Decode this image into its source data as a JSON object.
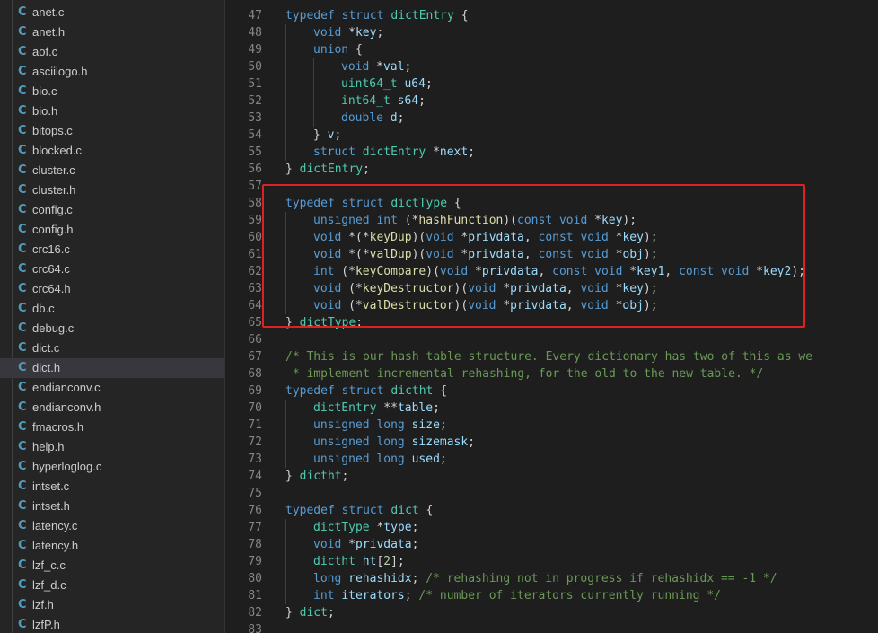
{
  "sidebar": {
    "files": [
      {
        "name": "anet.c",
        "icon": "C"
      },
      {
        "name": "anet.h",
        "icon": "C"
      },
      {
        "name": "aof.c",
        "icon": "C"
      },
      {
        "name": "asciilogo.h",
        "icon": "C"
      },
      {
        "name": "bio.c",
        "icon": "C"
      },
      {
        "name": "bio.h",
        "icon": "C"
      },
      {
        "name": "bitops.c",
        "icon": "C"
      },
      {
        "name": "blocked.c",
        "icon": "C"
      },
      {
        "name": "cluster.c",
        "icon": "C"
      },
      {
        "name": "cluster.h",
        "icon": "C"
      },
      {
        "name": "config.c",
        "icon": "C"
      },
      {
        "name": "config.h",
        "icon": "C"
      },
      {
        "name": "crc16.c",
        "icon": "C"
      },
      {
        "name": "crc64.c",
        "icon": "C"
      },
      {
        "name": "crc64.h",
        "icon": "C"
      },
      {
        "name": "db.c",
        "icon": "C"
      },
      {
        "name": "debug.c",
        "icon": "C"
      },
      {
        "name": "dict.c",
        "icon": "C"
      },
      {
        "name": "dict.h",
        "icon": "C",
        "active": true
      },
      {
        "name": "endianconv.c",
        "icon": "C"
      },
      {
        "name": "endianconv.h",
        "icon": "C"
      },
      {
        "name": "fmacros.h",
        "icon": "C"
      },
      {
        "name": "help.h",
        "icon": "C"
      },
      {
        "name": "hyperloglog.c",
        "icon": "C"
      },
      {
        "name": "intset.c",
        "icon": "C"
      },
      {
        "name": "intset.h",
        "icon": "C"
      },
      {
        "name": "latency.c",
        "icon": "C"
      },
      {
        "name": "latency.h",
        "icon": "C"
      },
      {
        "name": "lzf_c.c",
        "icon": "C"
      },
      {
        "name": "lzf_d.c",
        "icon": "C"
      },
      {
        "name": "lzf.h",
        "icon": "C"
      },
      {
        "name": "lzfP.h",
        "icon": "C"
      }
    ]
  },
  "editor": {
    "highlight_color": "#e02020",
    "lines": [
      {
        "n": "47",
        "i": 0,
        "t": [
          [
            "kw",
            "typedef"
          ],
          [
            "tx",
            " "
          ],
          [
            "kw",
            "struct"
          ],
          [
            "tx",
            " "
          ],
          [
            "ty",
            "dictEntry"
          ],
          [
            "tx",
            " {"
          ]
        ]
      },
      {
        "n": "48",
        "i": 1,
        "t": [
          [
            "kw",
            "void"
          ],
          [
            "tx",
            " *"
          ],
          [
            "vr",
            "key"
          ],
          [
            "tx",
            ";"
          ]
        ]
      },
      {
        "n": "49",
        "i": 1,
        "t": [
          [
            "kw",
            "union"
          ],
          [
            "tx",
            " {"
          ]
        ]
      },
      {
        "n": "50",
        "i": 2,
        "t": [
          [
            "kw",
            "void"
          ],
          [
            "tx",
            " *"
          ],
          [
            "vr",
            "val"
          ],
          [
            "tx",
            ";"
          ]
        ]
      },
      {
        "n": "51",
        "i": 2,
        "t": [
          [
            "ty",
            "uint64_t"
          ],
          [
            "tx",
            " "
          ],
          [
            "vr",
            "u64"
          ],
          [
            "tx",
            ";"
          ]
        ]
      },
      {
        "n": "52",
        "i": 2,
        "t": [
          [
            "ty",
            "int64_t"
          ],
          [
            "tx",
            " "
          ],
          [
            "vr",
            "s64"
          ],
          [
            "tx",
            ";"
          ]
        ]
      },
      {
        "n": "53",
        "i": 2,
        "t": [
          [
            "kw",
            "double"
          ],
          [
            "tx",
            " "
          ],
          [
            "vr",
            "d"
          ],
          [
            "tx",
            ";"
          ]
        ]
      },
      {
        "n": "54",
        "i": 1,
        "t": [
          [
            "tx",
            "} "
          ],
          [
            "vr",
            "v"
          ],
          [
            "tx",
            ";"
          ]
        ]
      },
      {
        "n": "55",
        "i": 1,
        "t": [
          [
            "kw",
            "struct"
          ],
          [
            "tx",
            " "
          ],
          [
            "ty",
            "dictEntry"
          ],
          [
            "tx",
            " *"
          ],
          [
            "vr",
            "next"
          ],
          [
            "tx",
            ";"
          ]
        ]
      },
      {
        "n": "56",
        "i": 0,
        "t": [
          [
            "tx",
            "} "
          ],
          [
            "ty",
            "dictEntry"
          ],
          [
            "tx",
            ";"
          ]
        ]
      },
      {
        "n": "57",
        "i": 0,
        "t": []
      },
      {
        "n": "58",
        "i": 0,
        "t": [
          [
            "kw",
            "typedef"
          ],
          [
            "tx",
            " "
          ],
          [
            "kw",
            "struct"
          ],
          [
            "tx",
            " "
          ],
          [
            "ty",
            "dictType"
          ],
          [
            "tx",
            " {"
          ]
        ]
      },
      {
        "n": "59",
        "i": 1,
        "t": [
          [
            "kw",
            "unsigned"
          ],
          [
            "tx",
            " "
          ],
          [
            "kw",
            "int"
          ],
          [
            "tx",
            " (*"
          ],
          [
            "fn",
            "hashFunction"
          ],
          [
            "tx",
            ")("
          ],
          [
            "kw",
            "const"
          ],
          [
            "tx",
            " "
          ],
          [
            "kw",
            "void"
          ],
          [
            "tx",
            " *"
          ],
          [
            "vr",
            "key"
          ],
          [
            "tx",
            ");"
          ]
        ]
      },
      {
        "n": "60",
        "i": 1,
        "t": [
          [
            "kw",
            "void"
          ],
          [
            "tx",
            " *(*"
          ],
          [
            "fn",
            "keyDup"
          ],
          [
            "tx",
            ")("
          ],
          [
            "kw",
            "void"
          ],
          [
            "tx",
            " *"
          ],
          [
            "vr",
            "privdata"
          ],
          [
            "tx",
            ", "
          ],
          [
            "kw",
            "const"
          ],
          [
            "tx",
            " "
          ],
          [
            "kw",
            "void"
          ],
          [
            "tx",
            " *"
          ],
          [
            "vr",
            "key"
          ],
          [
            "tx",
            ");"
          ]
        ]
      },
      {
        "n": "61",
        "i": 1,
        "t": [
          [
            "kw",
            "void"
          ],
          [
            "tx",
            " *(*"
          ],
          [
            "fn",
            "valDup"
          ],
          [
            "tx",
            ")("
          ],
          [
            "kw",
            "void"
          ],
          [
            "tx",
            " *"
          ],
          [
            "vr",
            "privdata"
          ],
          [
            "tx",
            ", "
          ],
          [
            "kw",
            "const"
          ],
          [
            "tx",
            " "
          ],
          [
            "kw",
            "void"
          ],
          [
            "tx",
            " *"
          ],
          [
            "vr",
            "obj"
          ],
          [
            "tx",
            ");"
          ]
        ]
      },
      {
        "n": "62",
        "i": 1,
        "t": [
          [
            "kw",
            "int"
          ],
          [
            "tx",
            " (*"
          ],
          [
            "fn",
            "keyCompare"
          ],
          [
            "tx",
            ")("
          ],
          [
            "kw",
            "void"
          ],
          [
            "tx",
            " *"
          ],
          [
            "vr",
            "privdata"
          ],
          [
            "tx",
            ", "
          ],
          [
            "kw",
            "const"
          ],
          [
            "tx",
            " "
          ],
          [
            "kw",
            "void"
          ],
          [
            "tx",
            " *"
          ],
          [
            "vr",
            "key1"
          ],
          [
            "tx",
            ", "
          ],
          [
            "kw",
            "const"
          ],
          [
            "tx",
            " "
          ],
          [
            "kw",
            "void"
          ],
          [
            "tx",
            " *"
          ],
          [
            "vr",
            "key2"
          ],
          [
            "tx",
            ");"
          ]
        ]
      },
      {
        "n": "63",
        "i": 1,
        "t": [
          [
            "kw",
            "void"
          ],
          [
            "tx",
            " (*"
          ],
          [
            "fn",
            "keyDestructor"
          ],
          [
            "tx",
            ")("
          ],
          [
            "kw",
            "void"
          ],
          [
            "tx",
            " *"
          ],
          [
            "vr",
            "privdata"
          ],
          [
            "tx",
            ", "
          ],
          [
            "kw",
            "void"
          ],
          [
            "tx",
            " *"
          ],
          [
            "vr",
            "key"
          ],
          [
            "tx",
            ");"
          ]
        ]
      },
      {
        "n": "64",
        "i": 1,
        "t": [
          [
            "kw",
            "void"
          ],
          [
            "tx",
            " (*"
          ],
          [
            "fn",
            "valDestructor"
          ],
          [
            "tx",
            ")("
          ],
          [
            "kw",
            "void"
          ],
          [
            "tx",
            " *"
          ],
          [
            "vr",
            "privdata"
          ],
          [
            "tx",
            ", "
          ],
          [
            "kw",
            "void"
          ],
          [
            "tx",
            " *"
          ],
          [
            "vr",
            "obj"
          ],
          [
            "tx",
            ");"
          ]
        ]
      },
      {
        "n": "65",
        "i": 0,
        "t": [
          [
            "tx",
            "} "
          ],
          [
            "ty",
            "dictType"
          ],
          [
            "tx",
            ";"
          ]
        ]
      },
      {
        "n": "66",
        "i": 0,
        "t": []
      },
      {
        "n": "67",
        "i": 0,
        "t": [
          [
            "cm",
            "/* This is our hash table structure. Every dictionary has two of this as we"
          ]
        ]
      },
      {
        "n": "68",
        "i": 0,
        "t": [
          [
            "cm",
            " * implement incremental rehashing, for the old to the new table. */"
          ]
        ]
      },
      {
        "n": "69",
        "i": 0,
        "t": [
          [
            "kw",
            "typedef"
          ],
          [
            "tx",
            " "
          ],
          [
            "kw",
            "struct"
          ],
          [
            "tx",
            " "
          ],
          [
            "ty",
            "dictht"
          ],
          [
            "tx",
            " {"
          ]
        ]
      },
      {
        "n": "70",
        "i": 1,
        "t": [
          [
            "ty",
            "dictEntry"
          ],
          [
            "tx",
            " **"
          ],
          [
            "vr",
            "table"
          ],
          [
            "tx",
            ";"
          ]
        ]
      },
      {
        "n": "71",
        "i": 1,
        "t": [
          [
            "kw",
            "unsigned"
          ],
          [
            "tx",
            " "
          ],
          [
            "kw",
            "long"
          ],
          [
            "tx",
            " "
          ],
          [
            "vr",
            "size"
          ],
          [
            "tx",
            ";"
          ]
        ]
      },
      {
        "n": "72",
        "i": 1,
        "t": [
          [
            "kw",
            "unsigned"
          ],
          [
            "tx",
            " "
          ],
          [
            "kw",
            "long"
          ],
          [
            "tx",
            " "
          ],
          [
            "vr",
            "sizemask"
          ],
          [
            "tx",
            ";"
          ]
        ]
      },
      {
        "n": "73",
        "i": 1,
        "t": [
          [
            "kw",
            "unsigned"
          ],
          [
            "tx",
            " "
          ],
          [
            "kw",
            "long"
          ],
          [
            "tx",
            " "
          ],
          [
            "vr",
            "used"
          ],
          [
            "tx",
            ";"
          ]
        ]
      },
      {
        "n": "74",
        "i": 0,
        "t": [
          [
            "tx",
            "} "
          ],
          [
            "ty",
            "dictht"
          ],
          [
            "tx",
            ";"
          ]
        ]
      },
      {
        "n": "75",
        "i": 0,
        "t": []
      },
      {
        "n": "76",
        "i": 0,
        "t": [
          [
            "kw",
            "typedef"
          ],
          [
            "tx",
            " "
          ],
          [
            "kw",
            "struct"
          ],
          [
            "tx",
            " "
          ],
          [
            "ty",
            "dict"
          ],
          [
            "tx",
            " {"
          ]
        ]
      },
      {
        "n": "77",
        "i": 1,
        "t": [
          [
            "ty",
            "dictType"
          ],
          [
            "tx",
            " *"
          ],
          [
            "vr",
            "type"
          ],
          [
            "tx",
            ";"
          ]
        ]
      },
      {
        "n": "78",
        "i": 1,
        "t": [
          [
            "kw",
            "void"
          ],
          [
            "tx",
            " *"
          ],
          [
            "vr",
            "privdata"
          ],
          [
            "tx",
            ";"
          ]
        ]
      },
      {
        "n": "79",
        "i": 1,
        "t": [
          [
            "ty",
            "dictht"
          ],
          [
            "tx",
            " "
          ],
          [
            "vr",
            "ht"
          ],
          [
            "tx",
            "["
          ],
          [
            "nm",
            "2"
          ],
          [
            "tx",
            "];"
          ]
        ]
      },
      {
        "n": "80",
        "i": 1,
        "t": [
          [
            "kw",
            "long"
          ],
          [
            "tx",
            " "
          ],
          [
            "vr",
            "rehashidx"
          ],
          [
            "tx",
            "; "
          ],
          [
            "cm",
            "/* rehashing not in progress if rehashidx == -1 */"
          ]
        ]
      },
      {
        "n": "81",
        "i": 1,
        "t": [
          [
            "kw",
            "int"
          ],
          [
            "tx",
            " "
          ],
          [
            "vr",
            "iterators"
          ],
          [
            "tx",
            "; "
          ],
          [
            "cm",
            "/* number of iterators currently running */"
          ]
        ]
      },
      {
        "n": "82",
        "i": 0,
        "t": [
          [
            "tx",
            "} "
          ],
          [
            "ty",
            "dict"
          ],
          [
            "tx",
            ";"
          ]
        ]
      },
      {
        "n": "83",
        "i": 0,
        "t": []
      }
    ]
  }
}
